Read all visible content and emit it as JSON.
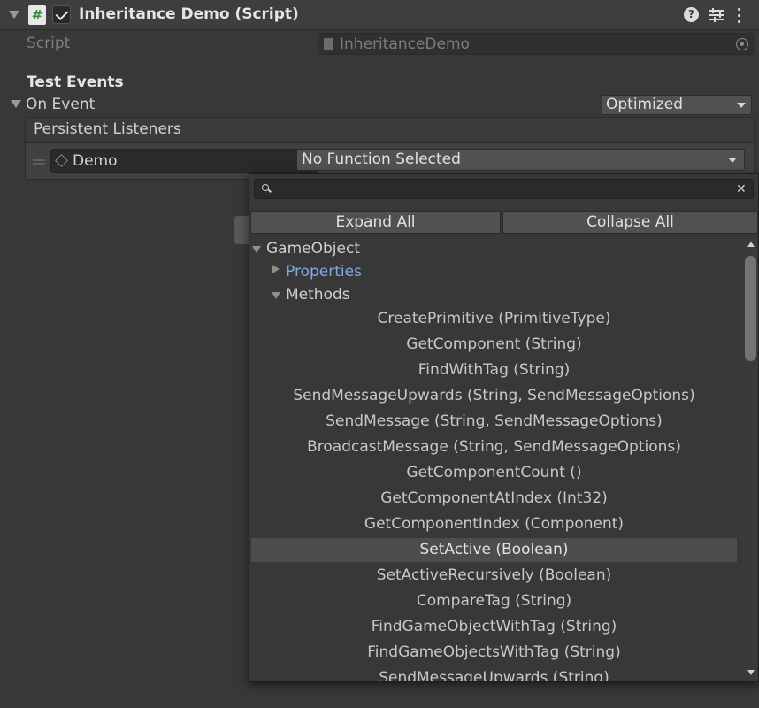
{
  "component": {
    "title": "Inheritance Demo (Script)",
    "enabled": true,
    "script_icon_glyph": "#",
    "help_glyph": "?",
    "icons": [
      "fold-arrow-icon",
      "script-icon",
      "enable-checkbox",
      "help-icon",
      "presets-icon",
      "kebab-menu-icon"
    ]
  },
  "script_row": {
    "label": "Script",
    "value": "InheritanceDemo"
  },
  "event": {
    "section_title": "Test Events",
    "event_label": "On Event",
    "mode": "Optimized",
    "listeners_header": "Persistent Listeners",
    "target_object": "Demo",
    "function_selection": "No Function Selected"
  },
  "popup": {
    "search_value": "",
    "clear_glyph": "✕",
    "expand_all_label": "Expand All",
    "collapse_all_label": "Collapse All",
    "root_node": "GameObject",
    "properties_node": "Properties",
    "methods_node": "Methods",
    "methods": [
      "CreatePrimitive (PrimitiveType)",
      "GetComponent (String)",
      "FindWithTag (String)",
      "SendMessageUpwards (String, SendMessageOptions)",
      "SendMessage (String, SendMessageOptions)",
      "BroadcastMessage (String, SendMessageOptions)",
      "GetComponentCount ()",
      "GetComponentAtIndex (Int32)",
      "GetComponentIndex (Component)",
      "SetActive (Boolean)",
      "SetActiveRecursively (Boolean)",
      "CompareTag (String)",
      "FindGameObjectWithTag (String)",
      "FindGameObjectsWithTag (String)",
      "SendMessageUpwards (String)"
    ],
    "selected_method": "SetActive (Boolean)",
    "scroll_position": 0.0
  },
  "colors": {
    "background": "#383838",
    "header": "#3e3e3e",
    "text": "#c4c4c4",
    "link_blue": "#7fa8e6",
    "selection": "#4d4d4d"
  }
}
